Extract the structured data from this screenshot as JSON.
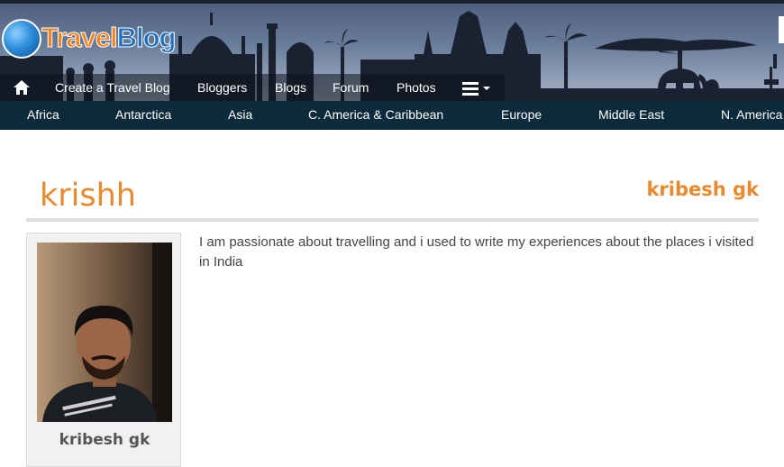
{
  "header": {
    "logo": {
      "part1": "Travel",
      "part2": "Blog"
    },
    "nav": [
      {
        "label": "Create a Travel Blog"
      },
      {
        "label": "Bloggers"
      },
      {
        "label": "Blogs"
      },
      {
        "label": "Forum"
      },
      {
        "label": "Photos"
      }
    ],
    "home_icon": "home-icon",
    "menu_icon": "hamburger-menu-icon"
  },
  "regions": [
    {
      "label": "Africa"
    },
    {
      "label": "Antarctica"
    },
    {
      "label": "Asia"
    },
    {
      "label": "C. America & Caribbean"
    },
    {
      "label": "Europe"
    },
    {
      "label": "Middle East"
    },
    {
      "label": "N. America"
    }
  ],
  "profile": {
    "title": "krishh",
    "author": "kribesh gk",
    "card_name": "kribesh gk",
    "bio": "I am passionate about travelling and i used to write my experiences about the places i visited in India"
  },
  "colors": {
    "accent": "#e8892d",
    "region_bar": "#0b2a3c",
    "nav_text": "#ffffff"
  }
}
